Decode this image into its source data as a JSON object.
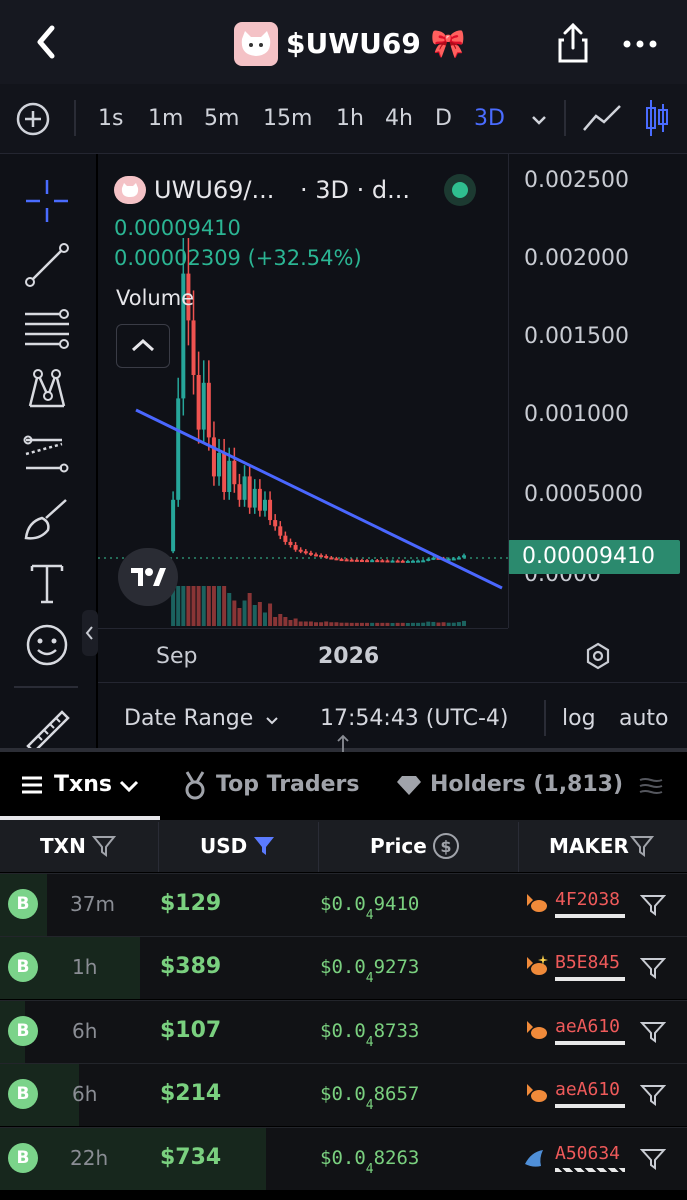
{
  "header": {
    "title": "$UWU69",
    "title_emoji": "🎀",
    "back_icon": "back-chevron-icon",
    "share_icon": "share-icon",
    "more_icon": "more-icon"
  },
  "timeframes": [
    "1s",
    "1m",
    "5m",
    "15m",
    "1h",
    "4h",
    "D",
    "3D"
  ],
  "selected_timeframe": "3D",
  "chart": {
    "symbol": "UWU69/...",
    "interval_label": "· 3D · d...",
    "last_price": "0.00009410",
    "change": "0.00002309 (+32.54%)",
    "volume_label": "Volume",
    "price_tag": "0.00009410",
    "colors": {
      "up": "#26a69a",
      "down": "#ef5350",
      "trendline": "#4a67ff",
      "accent": "#2b8a6e"
    }
  },
  "chart_data": {
    "type": "candlestick",
    "title": "UWU69/... · 3D",
    "y_ticks": [
      "0.002500",
      "0.002000",
      "0.001500",
      "0.001000",
      "0.0005000",
      "0.0000"
    ],
    "ylim": [
      0,
      0.0025
    ],
    "x_ticks": [
      "Sep",
      "2026"
    ],
    "last_value": 9.41e-05
  },
  "chart_footer": {
    "date_range": "Date Range",
    "time": "17:54:43 (UTC-4)",
    "log": "log",
    "auto": "auto"
  },
  "tabs": {
    "txns": "Txns",
    "top_traders": "Top Traders",
    "holders": "Holders (1,813)"
  },
  "table": {
    "headers": {
      "txn": "TXN",
      "usd": "USD",
      "price": "Price",
      "maker": "MAKER"
    },
    "rows": [
      {
        "type": "B",
        "age": "37m",
        "usd": "$129",
        "price_prefix": "$0.0",
        "price_zeros": "4",
        "price_digits": "9410",
        "maker": "4F2038",
        "fill": 0.13
      },
      {
        "type": "B",
        "age": "1h",
        "usd": "$389",
        "price_prefix": "$0.0",
        "price_zeros": "4",
        "price_digits": "9273",
        "maker": "B5E845",
        "fill": 0.39
      },
      {
        "type": "B",
        "age": "6h",
        "usd": "$107",
        "price_prefix": "$0.0",
        "price_zeros": "4",
        "price_digits": "8733",
        "maker": "aeA610",
        "fill": 0.07
      },
      {
        "type": "B",
        "age": "6h",
        "usd": "$214",
        "price_prefix": "$0.0",
        "price_zeros": "4",
        "price_digits": "8657",
        "maker": "aeA610",
        "fill": 0.22
      },
      {
        "type": "B",
        "age": "22h",
        "usd": "$734",
        "price_prefix": "$0.0",
        "price_zeros": "4",
        "price_digits": "8263",
        "maker": "A50634",
        "fill": 0.74
      }
    ]
  }
}
